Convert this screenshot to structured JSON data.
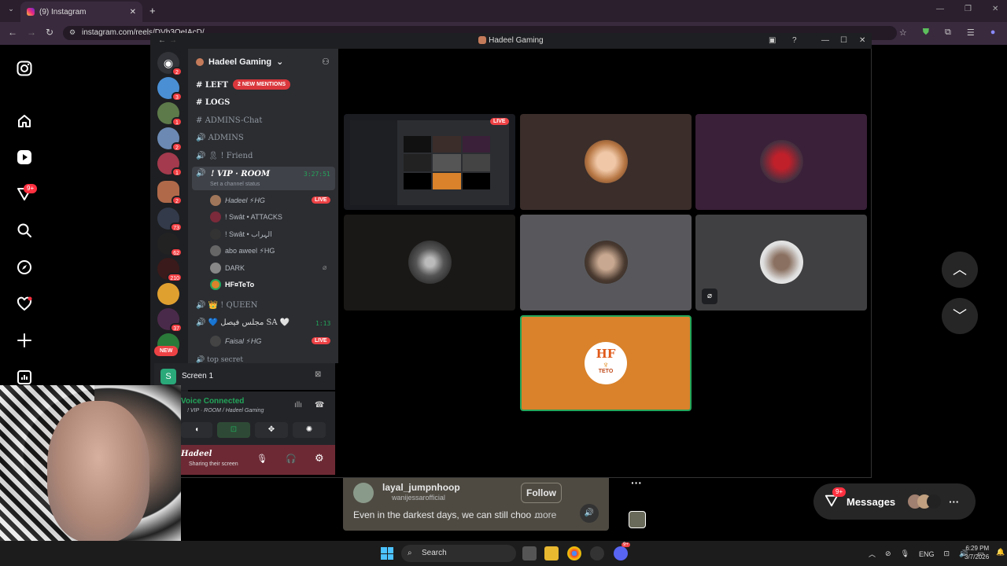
{
  "browser": {
    "tab_title": "(9) Instagram",
    "url": "instagram.com/reels/DVb3OeIAcD/"
  },
  "instagram": {
    "notifications_badge": "9+",
    "reel": {
      "username": "layal_jumpnhoop",
      "audio": "wanijessarofficial",
      "follow_label": "Follow",
      "caption": "Even in the darkest days, we can still choo ...",
      "more_label": "more"
    },
    "messages": {
      "label": "Messages",
      "badge": "9+"
    },
    "more_menu": "···"
  },
  "discord": {
    "window_title": "Hadeel Gaming",
    "server_name": "Hadeel Gaming",
    "server_badges": [
      "2",
      "3",
      "1",
      "2",
      "1",
      "2",
      "73",
      "62",
      "210",
      "37"
    ],
    "new_label": "NEW",
    "channels": [
      {
        "name": "LEFT",
        "mentions": "2 NEW MENTIONS"
      },
      {
        "name": "LOGS"
      },
      {
        "name": "ADMINS-Chat"
      },
      {
        "name": "ADMINS"
      },
      {
        "name": "🎗 ! Friend"
      }
    ],
    "active_channel": {
      "name": "! VIP · ROOM",
      "timer": "3:27:51",
      "status": "Set a channel status"
    },
    "vip_members": [
      {
        "name": "Hadeel ⚡HG",
        "live": "LIVE"
      },
      {
        "name": "! Swât • ATTACKS"
      },
      {
        "name": "! Swât • الہراب"
      },
      {
        "name": "abo aweel ⚡HG"
      },
      {
        "name": "DARK"
      },
      {
        "name": "HF¤TeTo"
      }
    ],
    "queen_channel": "! QUEEN",
    "sa_channel": "مجلس فيصل SA",
    "sa_timer": "1:13",
    "sa_members": [
      {
        "name": "Faisal ⚡HG",
        "live": "LIVE"
      }
    ],
    "hidden_channel": "top secret",
    "screen_label": "Screen 1",
    "voice_connected": "Voice Connected",
    "voice_channel": "! VIP · ROOM / Hadeel Gaming",
    "user_name": "Hadeel",
    "user_status": "Sharing their screen",
    "live_badge": "LIVE",
    "tile_logo_text": "HF",
    "tile_logo_sub": "TETO"
  },
  "taskbar": {
    "search_label": "Search",
    "discord_badge": "9+",
    "lang": "ENG",
    "time": "6:29 PM",
    "date": "3/7/2026"
  },
  "colors": {
    "discord_bg": "#2b2d31",
    "live_red": "#ed4245",
    "speaking_green": "#23a55a",
    "orange_tile": "#d9822b",
    "ig_badge": "#ff3040"
  }
}
